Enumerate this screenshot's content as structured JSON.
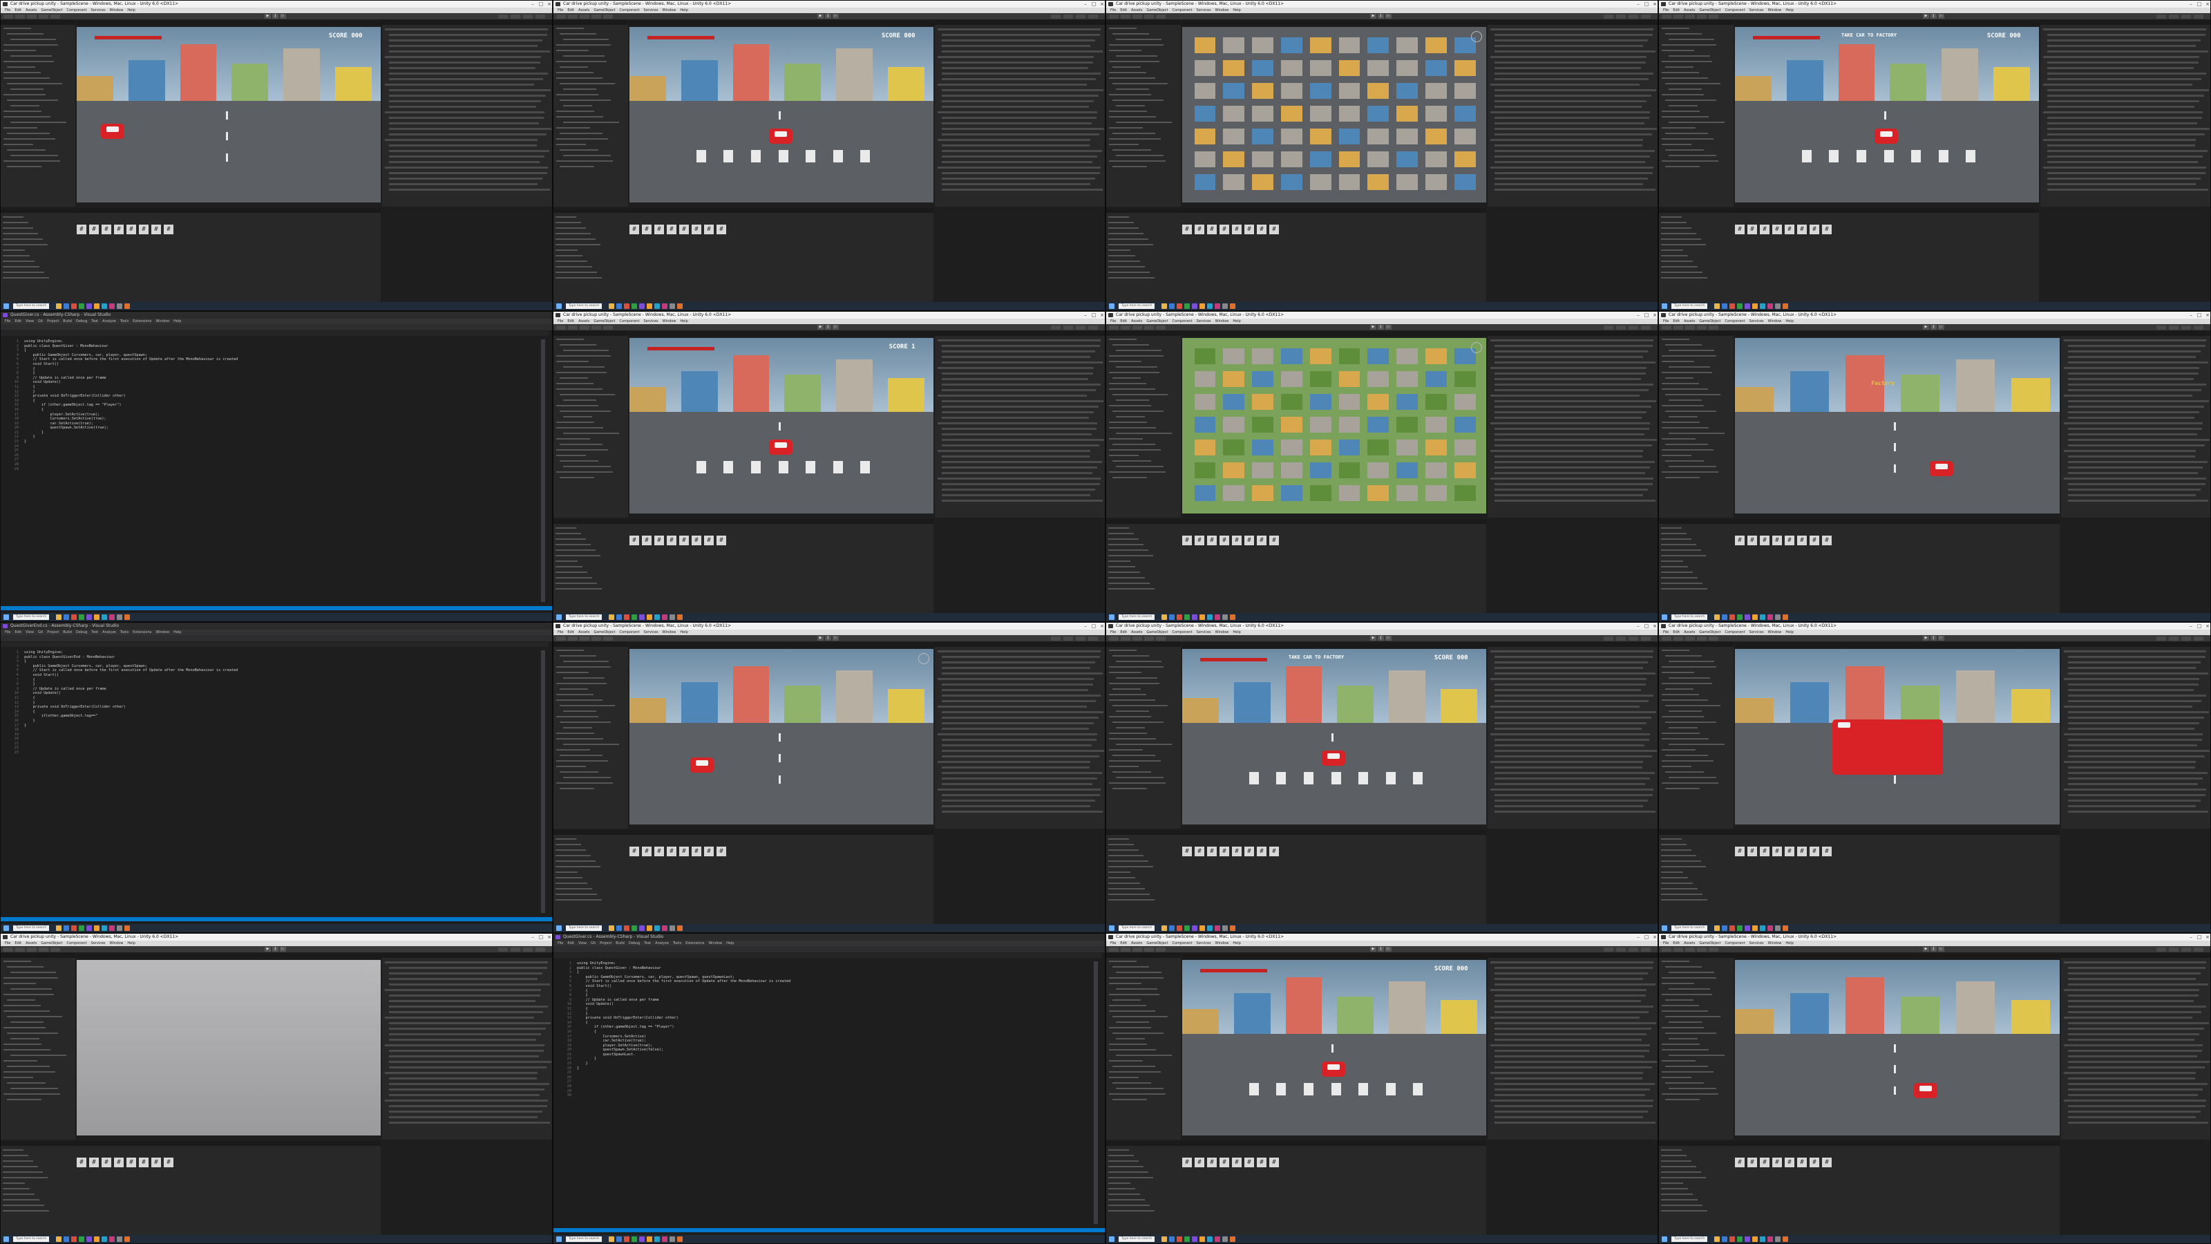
{
  "tiles": [
    {
      "title": "Car drive pickup unity - SampleScene - Windows, Mac, Linux - Unity 6.0 <DX11>",
      "menu": [
        "File",
        "Edit",
        "Assets",
        "GameObject",
        "Component",
        "Services",
        "Window",
        "Help"
      ],
      "view": "game-chase",
      "score": "SCORE 000",
      "search": "Type here to search"
    },
    {
      "title": "Car drive pickup unity - SampleScene - Windows, Mac, Linux - Unity 6.0 <DX11>",
      "menu": [
        "File",
        "Edit",
        "Assets",
        "GameObject",
        "Component",
        "Services",
        "Window",
        "Help"
      ],
      "view": "game-crosswalk",
      "score": "SCORE 000",
      "search": "Type here to search"
    },
    {
      "title": "Car drive pickup unity - SampleScene - Windows, Mac, Linux - Unity 6.0 <DX11>",
      "menu": [
        "File",
        "Edit",
        "Assets",
        "GameObject",
        "Component",
        "Services",
        "Window",
        "Help"
      ],
      "view": "scene-city",
      "score": "",
      "search": "Type here to search"
    },
    {
      "title": "Car drive pickup unity - SampleScene - Windows, Mac, Linux - Unity 6.0 <DX11>",
      "menu": [
        "File",
        "Edit",
        "Assets",
        "GameObject",
        "Component",
        "Services",
        "Window",
        "Help"
      ],
      "view": "game-crosswalk",
      "score": "SCORE 000",
      "banner": "TAKE CAR TO FACTORY",
      "search": "Type here to search"
    },
    {
      "title": "QuestGiver.cs - Assembly-CSharp - Visual Studio",
      "menu": [
        "File",
        "Edit",
        "View",
        "Git",
        "Project",
        "Build",
        "Debug",
        "Test",
        "Analyze",
        "Tools",
        "Extensions",
        "Window",
        "Help"
      ],
      "view": "code-questgiver",
      "search": "Type here to search"
    },
    {
      "title": "Car drive pickup unity - SampleScene - Windows, Mac, Linux - Unity 6.0 <DX11>",
      "menu": [
        "File",
        "Edit",
        "Assets",
        "GameObject",
        "Component",
        "Services",
        "Window",
        "Help"
      ],
      "view": "game-street",
      "score": "SCORE 1",
      "search": "Type here to search"
    },
    {
      "title": "Car drive pickup unity - SampleScene - Windows, Mac, Linux - Unity 6.0 <DX11>",
      "menu": [
        "File",
        "Edit",
        "Assets",
        "GameObject",
        "Component",
        "Services",
        "Window",
        "Help"
      ],
      "view": "scene-city-green",
      "score": "",
      "search": "Type here to search"
    },
    {
      "title": "Car drive pickup unity - SampleScene - Windows, Mac, Linux - Unity 6.0 <DX11>",
      "menu": [
        "File",
        "Edit",
        "Assets",
        "GameObject",
        "Component",
        "Services",
        "Window",
        "Help"
      ],
      "view": "scene-factory",
      "score": "",
      "factory": "Factory",
      "search": "Type here to search"
    },
    {
      "title": "QuestGiverEnd.cs - Assembly-CSharp - Visual Studio",
      "menu": [
        "File",
        "Edit",
        "View",
        "Git",
        "Project",
        "Build",
        "Debug",
        "Test",
        "Analyze",
        "Tools",
        "Extensions",
        "Window",
        "Help"
      ],
      "view": "code-questgiverend",
      "search": "Type here to search"
    },
    {
      "title": "Car drive pickup unity - SampleScene - Windows, Mac, Linux - Unity 6.0 <DX11>",
      "menu": [
        "File",
        "Edit",
        "Assets",
        "GameObject",
        "Component",
        "Services",
        "Window",
        "Help"
      ],
      "view": "scene-field",
      "score": "",
      "search": "Type here to search"
    },
    {
      "title": "Car drive pickup unity - SampleScene - Windows, Mac, Linux - Unity 6.0 <DX11>",
      "menu": [
        "File",
        "Edit",
        "Assets",
        "GameObject",
        "Component",
        "Services",
        "Window",
        "Help"
      ],
      "view": "game-crosswalk",
      "score": "SCORE 000",
      "banner": "TAKE CAR TO FACTORY",
      "search": "Type here to search"
    },
    {
      "title": "Car drive pickup unity - SampleScene - Windows, Mac, Linux - Unity 6.0 <DX11>",
      "menu": [
        "File",
        "Edit",
        "Assets",
        "GameObject",
        "Component",
        "Services",
        "Window",
        "Help"
      ],
      "view": "scene-car-closeup",
      "score": "",
      "search": "Type here to search"
    },
    {
      "title": "Car drive pickup unity - SampleScene - Windows, Mac, Linux - Unity 6.0 <DX11>",
      "menu": [
        "File",
        "Edit",
        "Assets",
        "GameObject",
        "Component",
        "Services",
        "Window",
        "Help"
      ],
      "view": "scene-empty",
      "score": "",
      "search": "Type here to search"
    },
    {
      "title": "QuestGiver.cs - Assembly-CSharp - Visual Studio",
      "menu": [
        "File",
        "Edit",
        "View",
        "Git",
        "Project",
        "Build",
        "Debug",
        "Test",
        "Analyze",
        "Tools",
        "Extensions",
        "Window",
        "Help"
      ],
      "view": "code-questgiver-2",
      "search": "Type here to search"
    },
    {
      "title": "Car drive pickup unity - SampleScene - Windows, Mac, Linux - Unity 6.0 <DX11>",
      "menu": [
        "File",
        "Edit",
        "Assets",
        "GameObject",
        "Component",
        "Services",
        "Window",
        "Help"
      ],
      "view": "game-crosswalk",
      "score": "SCORE 000",
      "search": "Type here to search"
    },
    {
      "title": "Car drive pickup unity - SampleScene - Windows, Mac, Linux - Unity 6.0 <DX11>",
      "menu": [
        "File",
        "Edit",
        "Assets",
        "GameObject",
        "Component",
        "Services",
        "Window",
        "Help"
      ],
      "view": "scene-street",
      "score": "",
      "search": "Type here to search"
    }
  ],
  "code": {
    "questgiver": [
      "using UnityEngine;",
      "",
      "public class QuestGiver : MonoBehaviour",
      "{",
      "    public GameObject Cursomers, car, player, questSpawn;",
      "",
      "    // Start is called once before the first execution of Update after the MonoBehaviour is created",
      "    void Start()",
      "    {",
      "",
      "    }",
      "",
      "    // Update is called once per frame",
      "    void Update()",
      "    {",
      "",
      "    }",
      "",
      "    private void OnTriggerEnter(Collider other)",
      "    {",
      "        if (other.gameObject.tag == \"Player\")",
      "        {",
      "            player.SetActive(true);",
      "            Cursomers.SetActive(true);",
      "            car.SetActive(true);",
      "            questSpawn.SetActive(true);",
      "        }",
      "    }",
      "}"
    ],
    "questgiverend": [
      "using UnityEngine;",
      "",
      "public class QuestGiverEnd : MonoBehaviour",
      "{",
      "    public GameObject Cursomers, car, player, questSpawn;",
      "",
      "    // Start is called once before the first execution of Update after the MonoBehaviour is created",
      "    void Start()",
      "    {",
      "",
      "    }",
      "",
      "    // Update is called once per frame",
      "    void Update()",
      "    {",
      "",
      "    }",
      "",
      "    private void OnTriggerEnter(Collider other)",
      "    {",
      "        if(other.gameObject.tag==\"",
      "    }",
      "}"
    ],
    "questgiver2": [
      "using UnityEngine;",
      "",
      "public class QuestGiver : MonoBehaviour",
      "{",
      "    public GameObject Cursomers, car, player, questSpawn, questSpawnLast;",
      "",
      "    // Start is called once before the first execution of Update after the MonoBehaviour is created",
      "    void Start()",
      "    {",
      "",
      "    }",
      "",
      "    // Update is called once per frame",
      "    void Update()",
      "    {",
      "",
      "    }",
      "",
      "    private void OnTriggerEnter(Collider other)",
      "    {",
      "        if (other.gameObject.tag == \"Player\")",
      "        {",
      "            Cursomers.SetActive(",
      "            car.SetActive(true);",
      "            player.SetActive(true);",
      "            questSpawn.SetActive(false);",
      "            questSpawnLast.",
      "        }",
      "    }",
      "}"
    ]
  },
  "colors": {
    "accent": "#d82226",
    "road": "#5c5f63",
    "sky": "#a9bfd1",
    "grass": "#5f8e3a",
    "editor_bg": "#1e1e1e",
    "panel_bg": "#282828"
  }
}
